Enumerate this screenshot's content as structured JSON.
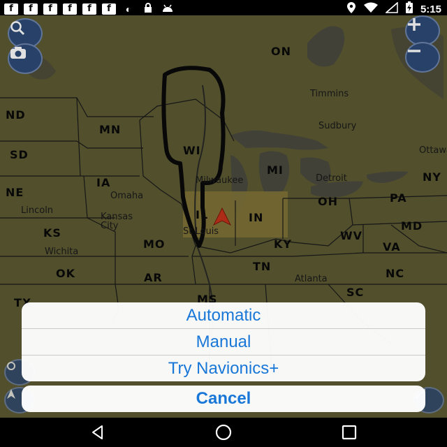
{
  "status_bar": {
    "notification_icons": [
      "facebook-icon",
      "facebook-icon",
      "facebook-icon",
      "facebook-icon",
      "facebook-icon",
      "facebook-icon"
    ],
    "time": "5:15"
  },
  "map": {
    "regions": [
      "ON",
      "ND",
      "MN",
      "SD",
      "WI",
      "MI",
      "NE",
      "IA",
      "IL",
      "IN",
      "OH",
      "PA",
      "NY",
      "KS",
      "MO",
      "KY",
      "WV",
      "MD",
      "VA",
      "OK",
      "AR",
      "TN",
      "NC",
      "MS",
      "SC",
      "TX"
    ],
    "cities": [
      "Timmins",
      "Sudbury",
      "Ottawa",
      "Milwaukee",
      "Detroit",
      "Omaha",
      "Lincoln",
      "Kansas City",
      "St Louis",
      "Wichita",
      "Atlanta"
    ],
    "buttons": {
      "search_icon": "search-icon",
      "camera_icon": "camera-icon",
      "zoom_in_icon": "plus-icon",
      "zoom_out_icon": "minus-icon"
    }
  },
  "action_sheet": {
    "options": [
      "Automatic",
      "Manual",
      "Try Navionics+"
    ],
    "cancel_label": "Cancel",
    "accent_color": "#1977d8"
  },
  "nav_bar": {
    "icons": [
      "back-icon",
      "home-icon",
      "recents-icon"
    ]
  }
}
